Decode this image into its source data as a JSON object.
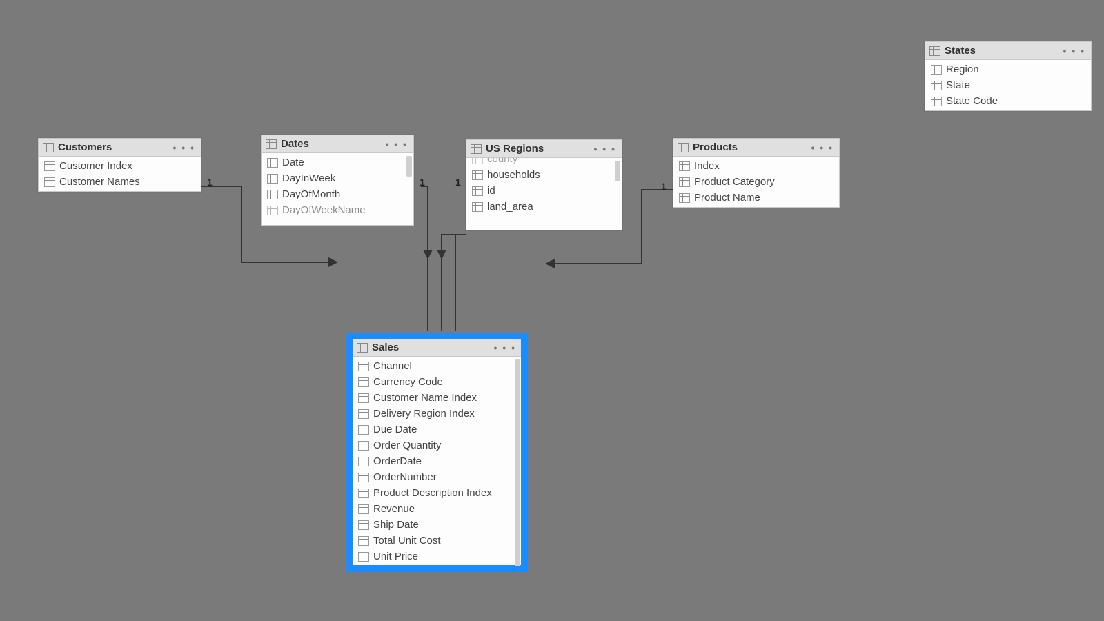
{
  "tables": {
    "customers": {
      "title": "Customers",
      "fields": [
        "Customer Index",
        "Customer Names"
      ]
    },
    "dates": {
      "title": "Dates",
      "fields": [
        "Date",
        "DayInWeek",
        "DayOfMonth",
        "DayOfWeekName"
      ]
    },
    "usregions": {
      "title": "US Regions",
      "fields": [
        "county",
        "households",
        "id",
        "land_area"
      ]
    },
    "products": {
      "title": "Products",
      "fields": [
        "Index",
        "Product Category",
        "Product Name"
      ]
    },
    "states": {
      "title": "States",
      "fields": [
        "Region",
        "State",
        "State Code"
      ]
    },
    "sales": {
      "title": "Sales",
      "fields": [
        "Channel",
        "Currency Code",
        "Customer Name Index",
        "Delivery Region Index",
        "Due Date",
        "Order Quantity",
        "OrderDate",
        "OrderNumber",
        "Product Description Index",
        "Revenue",
        "Ship Date",
        "Total Unit Cost",
        "Unit Price"
      ]
    }
  },
  "cardinality": {
    "one": "1"
  },
  "menu_dots": "• • •"
}
